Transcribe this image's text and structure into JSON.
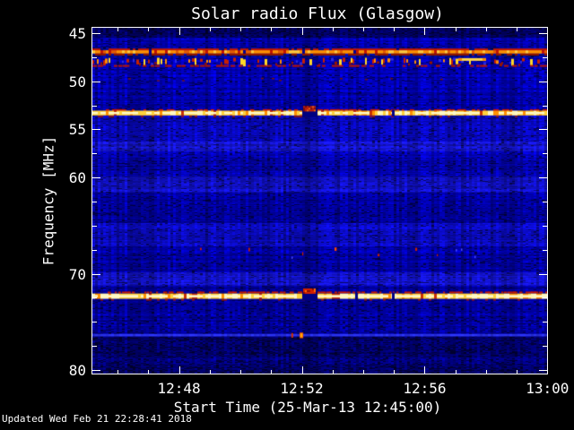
{
  "footer": {
    "updated_text": "Updated Wed Feb 21 22:28:41 2018"
  },
  "colors": {
    "background": "#000000",
    "axis": "#ffffff",
    "text": "#ffffff",
    "base_blue": "#0000b4",
    "dark_navy": "#000068",
    "bright_blue": "#2a32e8",
    "hot_red": "#c81400",
    "hot_orange": "#ff9100",
    "hot_yellow": "#ffd73c",
    "hot_white": "#fff4aa"
  },
  "chart_data": {
    "type": "heatmap",
    "subtype": "radio-dynamic-spectrum",
    "title": "Solar radio Flux (Glasgow)",
    "xlabel": "Start Time (25-Mar-13 12:45:00)",
    "ylabel": "Frequency [MHz]",
    "colormap": "blue (low) through red/orange/yellow to white (high intensity)",
    "grid": false,
    "legend": false,
    "axes": {
      "x": {
        "label": "Start Time (25-Mar-13 12:45:00)",
        "start_time": "12:45:00",
        "end_time": "13:00",
        "major_tick_minutes": [
          3,
          7,
          11,
          15
        ],
        "major_tick_labels": [
          "12:48",
          "12:52",
          "12:56",
          "13:00"
        ],
        "minor_tick_minutes": [
          1,
          2,
          4,
          5,
          6,
          8,
          9,
          10,
          12,
          13,
          14
        ]
      },
      "y": {
        "label": "Frequency [MHz]",
        "unit": "MHz",
        "major_ticks": [
          45,
          50,
          55,
          60,
          70,
          80
        ],
        "major_tick_labels": [
          "45",
          "50",
          "55",
          "60",
          "70",
          "80"
        ],
        "minor_ticks": [
          47.5,
          52.5,
          57.5,
          62.5,
          65,
          67.5,
          72.5,
          75,
          77.5
        ],
        "top_freq": 44.44,
        "bottom_freq": 80.5,
        "direction": "increasing-downward"
      }
    },
    "data_gap": {
      "time_label": "~12:52:00-12:52:30",
      "time_minutes": [
        7.0,
        7.45
      ],
      "appearance": "dark navy gap with bright red blob on the strong emission bands"
    },
    "features": [
      {
        "id": "dark-top",
        "freq_mhz": [
          44.44,
          45.55
        ],
        "kind": "low-signal",
        "appearance": "dark navy band across full duration"
      },
      {
        "id": "band-47",
        "freq_mhz": [
          46.6,
          47.35
        ],
        "kind": "emission-line",
        "strength": "strong",
        "appearance": "continuous band: red upper edge, orange-yellow core, dark-red lower edge"
      },
      {
        "id": "rfi-48",
        "freq_mhz": [
          47.55,
          48.45
        ],
        "kind": "intermittent-rfi",
        "appearance": "dense red/orange/yellow vertical dashes on blue, dashed dark-red lower edge"
      },
      {
        "id": "rfi-48-streak",
        "freq_mhz": [
          47.6,
          47.9
        ],
        "time_minutes": [
          12.1,
          13.0
        ],
        "kind": "rfi-burst",
        "appearance": "solid yellow streak near 12:57-12:58"
      },
      {
        "id": "smudge-49",
        "freq_mhz": [
          49.6,
          49.9
        ],
        "kind": "faint-rfi",
        "appearance": "sparse faint dark-red smudges"
      },
      {
        "id": "band-53",
        "freq_mhz": [
          52.9,
          53.6
        ],
        "kind": "emission-line",
        "strength": "strong",
        "appearance": "bright yellow-white band, red dotted upper edge, interrupted by data gap at ~12:52"
      },
      {
        "id": "bg-band-57",
        "freq_mhz": [
          56.35,
          57.35
        ],
        "kind": "enhanced-background",
        "appearance": "brighter mottled blue band"
      },
      {
        "id": "bg-band-60",
        "freq_mhz": [
          59.9,
          61.6
        ],
        "kind": "enhanced-background",
        "appearance": "brighter mottled blue band"
      },
      {
        "id": "bg-band-65",
        "freq_mhz": [
          64.8,
          67.2
        ],
        "kind": "enhanced-background",
        "appearance": "brighter mottled blue band"
      },
      {
        "id": "specks-67",
        "freq_mhz": [
          67.2,
          68.3
        ],
        "kind": "sparse-rfi",
        "appearance": "scattered short red specks"
      },
      {
        "id": "bg-band-70",
        "freq_mhz": [
          69.85,
          71.25
        ],
        "kind": "enhanced-background",
        "appearance": "brighter mottled blue band"
      },
      {
        "id": "band-72",
        "freq_mhz": [
          71.9,
          72.65
        ],
        "kind": "emission-line",
        "strength": "strongest",
        "appearance": "very bright white-yellow band, red dotted edges, interrupted by data gap at ~12:52"
      },
      {
        "id": "line-76",
        "freq_mhz": [
          76.25,
          76.5
        ],
        "kind": "weak-line",
        "appearance": "thin bright blue line with two small red bursts just before 12:52"
      },
      {
        "id": "dark-bottom",
        "freq_mhz": [
          76.55,
          80.5
        ],
        "kind": "low-signal",
        "appearance": "dark navy mottled region"
      }
    ]
  }
}
